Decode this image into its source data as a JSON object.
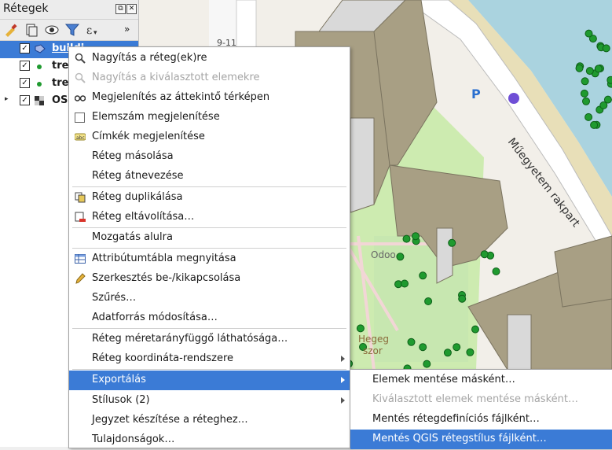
{
  "panel": {
    "title": "Rétegek",
    "header_buttons": [
      "⧉",
      "✕"
    ],
    "layers": [
      {
        "label": "buildi",
        "checked": true,
        "icon": "polygon-layer-icon",
        "selected": true
      },
      {
        "label": "tre",
        "checked": true,
        "icon": "point-layer-icon",
        "selected": false
      },
      {
        "label": "tre",
        "checked": true,
        "icon": "point-layer-icon",
        "selected": false
      },
      {
        "label": "OS",
        "checked": true,
        "icon": "raster-layer-icon",
        "selected": false
      }
    ]
  },
  "menu": {
    "items": [
      {
        "label": "Nagyítás a réteg(ek)re",
        "icon": "zoom-icon",
        "enabled": true
      },
      {
        "label": "Nagyítás a kiválasztott elemekre",
        "icon": "zoom-icon",
        "enabled": false
      },
      {
        "label": "Megjelenítés az áttekintő térképen",
        "icon": "overview-icon",
        "enabled": true
      },
      {
        "label": "Elemszám megjelenítése",
        "icon": "checkbox-icon",
        "enabled": true
      },
      {
        "label": "Címkék megjelenítése",
        "icon": "labels-icon",
        "enabled": true
      },
      {
        "label": "Réteg másolása",
        "icon": "",
        "enabled": true
      },
      {
        "label": "Réteg átnevezése",
        "icon": "",
        "enabled": true
      },
      {
        "label": "Réteg duplikálása",
        "icon": "duplicate-icon",
        "enabled": true
      },
      {
        "label": "Réteg eltávolítása…",
        "icon": "remove-icon",
        "enabled": true
      },
      {
        "label": "Mozgatás alulra",
        "icon": "",
        "enabled": true
      },
      {
        "label": "Attribútumtábla megnyitása",
        "icon": "table-icon",
        "enabled": true
      },
      {
        "label": "Szerkesztés be-/kikapcsolása",
        "icon": "pencil-icon",
        "enabled": true
      },
      {
        "label": "Szűrés…",
        "icon": "",
        "enabled": true
      },
      {
        "label": "Adatforrás módosítása…",
        "icon": "",
        "enabled": true
      },
      {
        "label": "Réteg méretarányfüggő láthatósága…",
        "icon": "",
        "enabled": true
      },
      {
        "label": "Réteg koordináta-rendszere",
        "icon": "",
        "enabled": true,
        "submenu": true
      },
      {
        "label": "Exportálás",
        "icon": "",
        "enabled": true,
        "submenu": true,
        "highlighted": true
      },
      {
        "label": "Stílusok (2)",
        "icon": "",
        "enabled": true,
        "submenu": true
      },
      {
        "label": "Jegyzet készítése a réteghez…",
        "icon": "",
        "enabled": true
      },
      {
        "label": "Tulajdonságok…",
        "icon": "",
        "enabled": true
      }
    ]
  },
  "submenu": {
    "items": [
      {
        "label": "Elemek mentése másként…",
        "enabled": true
      },
      {
        "label": "Kiválasztott elemek mentése másként…",
        "enabled": false
      },
      {
        "label": "Mentés rétegdefiníciós fájlként…",
        "enabled": true
      },
      {
        "label": "Mentés QGIS rétegstílus fájlként…",
        "enabled": true,
        "highlighted": true
      }
    ]
  },
  "map": {
    "labels": {
      "street": "Műegyetem rakpart",
      "house_number": "9-11",
      "shop": "Odoo",
      "place": "Hegeg szor",
      "parking": "P"
    }
  },
  "colors": {
    "highlight": "#3b7bd6",
    "building": "#a89f84",
    "tree": "#1f9a2f",
    "water": "#aad3df"
  }
}
